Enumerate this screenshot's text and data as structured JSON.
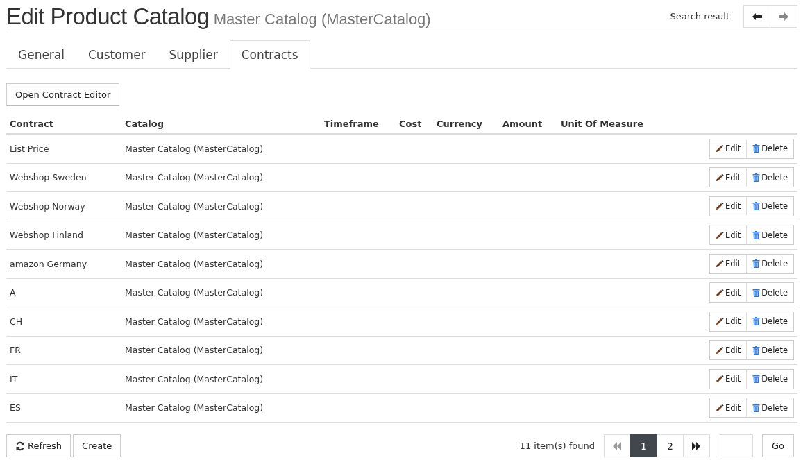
{
  "header": {
    "title": "Edit Product Catalog",
    "subtitle": "Master Catalog (MasterCatalog)",
    "search_result": "Search result",
    "nav": [
      {
        "kind": "back",
        "disabled": false
      },
      {
        "kind": "forward",
        "disabled": true
      }
    ]
  },
  "tabs": [
    {
      "label": "General",
      "selected": false
    },
    {
      "label": "Customer",
      "selected": false
    },
    {
      "label": "Supplier",
      "selected": false
    },
    {
      "label": "Contracts",
      "selected": true
    }
  ],
  "open_editor_button": "Open Contract Editor",
  "table": {
    "columns": [
      "Contract",
      "Catalog",
      "Timeframe",
      "Cost",
      "Currency",
      "Amount",
      "Unit Of Measure"
    ],
    "rows": [
      {
        "contract": "List Price",
        "catalog": "Master Catalog (MasterCatalog)",
        "edit": "Edit",
        "delete": "Delete"
      },
      {
        "contract": "Webshop Sweden",
        "catalog": "Master Catalog (MasterCatalog)",
        "edit": "Edit",
        "delete": "Delete"
      },
      {
        "contract": "Webshop Norway",
        "catalog": "Master Catalog (MasterCatalog)",
        "edit": "Edit",
        "delete": "Delete"
      },
      {
        "contract": "Webshop Finland",
        "catalog": "Master Catalog (MasterCatalog)",
        "edit": "Edit",
        "delete": "Delete"
      },
      {
        "contract": "amazon Germany",
        "catalog": "Master Catalog (MasterCatalog)",
        "edit": "Edit",
        "delete": "Delete"
      },
      {
        "contract": "A",
        "catalog": "Master Catalog (MasterCatalog)",
        "edit": "Edit",
        "delete": "Delete"
      },
      {
        "contract": "CH",
        "catalog": "Master Catalog (MasterCatalog)",
        "edit": "Edit",
        "delete": "Delete"
      },
      {
        "contract": "FR",
        "catalog": "Master Catalog (MasterCatalog)",
        "edit": "Edit",
        "delete": "Delete"
      },
      {
        "contract": "IT",
        "catalog": "Master Catalog (MasterCatalog)",
        "edit": "Edit",
        "delete": "Delete"
      },
      {
        "contract": "ES",
        "catalog": "Master Catalog (MasterCatalog)",
        "edit": "Edit",
        "delete": "Delete"
      }
    ]
  },
  "footer": {
    "refresh": "Refresh",
    "create": "Create",
    "count": "11 item(s) found",
    "pager": [
      {
        "kind": "first",
        "disabled": true
      },
      {
        "kind": "page",
        "label": "1",
        "selected": true
      },
      {
        "kind": "page",
        "label": "2",
        "selected": false
      },
      {
        "kind": "last",
        "disabled": false
      }
    ],
    "go": "Go"
  }
}
